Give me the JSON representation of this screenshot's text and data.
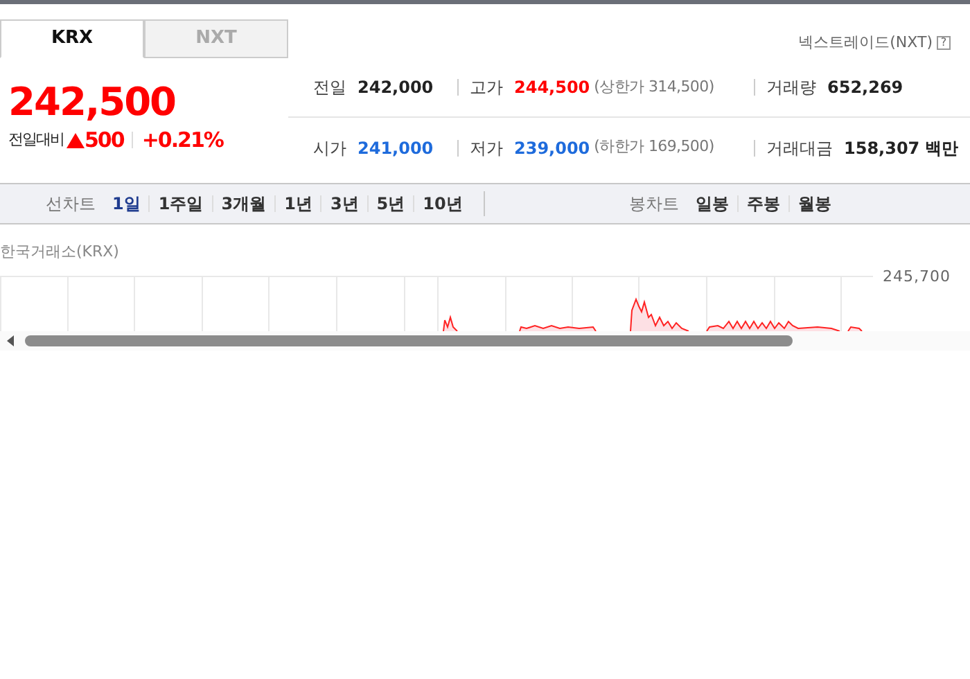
{
  "market_tabs": [
    {
      "label": "KRX",
      "selected": true
    },
    {
      "label": "NXT",
      "selected": false
    }
  ],
  "nxt_link": "넥스트레이드(NXT)",
  "help_icon_text": "?",
  "price": "242,500",
  "change": {
    "label": "전일대비",
    "color": "#ff0000",
    "amount": "500",
    "percent": "+0.21%"
  },
  "stats": [
    {
      "label": "전일",
      "value": "242,000",
      "color": "#222222"
    },
    {
      "label": "고가",
      "value": "244,500",
      "color": "#ff0000",
      "limit": "(상한가 314,500)"
    },
    {
      "label": "거래량",
      "value": "652,269",
      "color": "#222222"
    },
    {
      "label": "시가",
      "value": "241,000",
      "color": "#1e6bdc"
    },
    {
      "label": "저가",
      "value": "239,000",
      "color": "#1e6bdc",
      "limit": "(하한가 169,500)"
    },
    {
      "label": "거래대금",
      "value": "158,307",
      "unit": "백만",
      "color": "#222222"
    }
  ],
  "line_chart": {
    "label": "선차트",
    "options": [
      {
        "label": "1일",
        "selected": true
      },
      {
        "label": "1주일",
        "selected": false
      },
      {
        "label": "3개월",
        "selected": false
      },
      {
        "label": "1년",
        "selected": false
      },
      {
        "label": "3년",
        "selected": false
      },
      {
        "label": "5년",
        "selected": false
      },
      {
        "label": "10년",
        "selected": false
      }
    ]
  },
  "candle_chart": {
    "label": "봉차트",
    "options": [
      {
        "label": "일봉",
        "selected": false
      },
      {
        "label": "주봉",
        "selected": false
      },
      {
        "label": "월봉",
        "selected": false
      }
    ]
  },
  "chart": {
    "exchange": "한국거래소(KRX)",
    "y_label": "245,700"
  }
}
